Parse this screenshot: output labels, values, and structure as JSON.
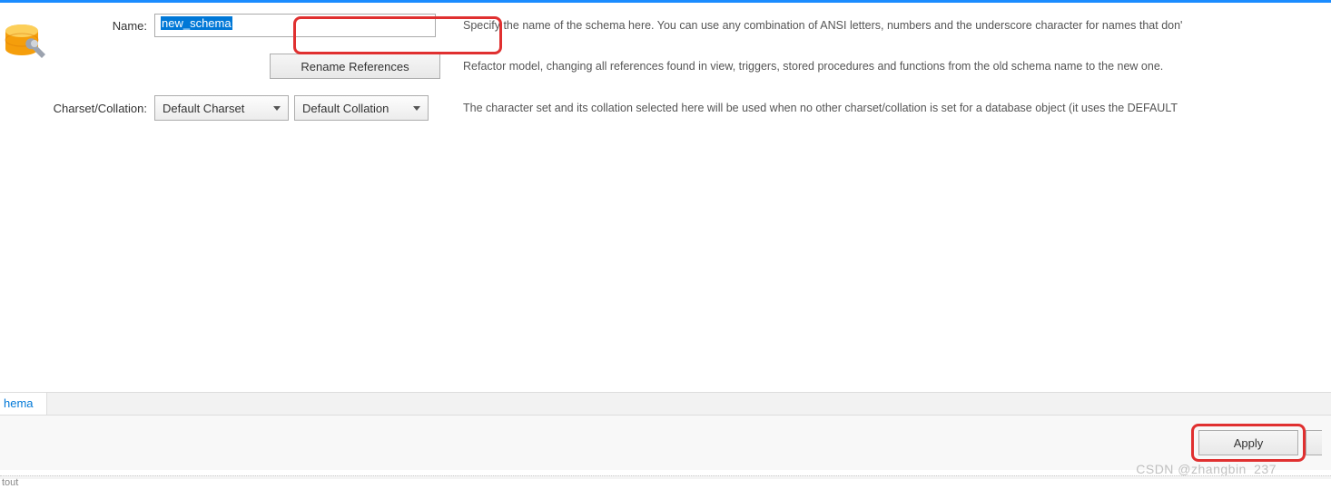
{
  "form": {
    "name_label": "Name:",
    "name_value": "new_schema",
    "name_desc": "Specify the name of the schema here. You can use any combination of ANSI letters, numbers and the underscore character for names that don'",
    "rename_button": "Rename References",
    "rename_desc": "Refactor model, changing all references found in view, triggers, stored procedures and functions from the old schema name to the new one.",
    "charset_label": "Charset/Collation:",
    "charset_value": "Default Charset",
    "collation_value": "Default Collation",
    "charset_desc": "The character set and its collation selected here will be used when no other charset/collation is set for a database object (it uses the DEFAULT"
  },
  "tabs": {
    "active": "hema"
  },
  "actions": {
    "apply": "Apply"
  },
  "footer": {
    "label": "tout"
  },
  "watermark": "CSDN @zhangbin_237"
}
